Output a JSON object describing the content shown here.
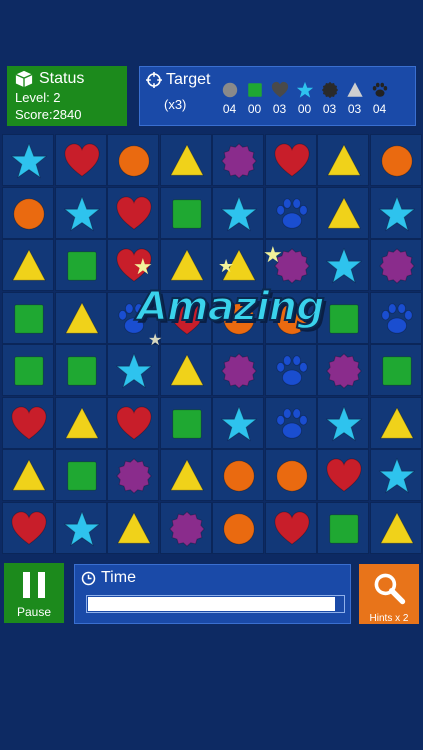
{
  "status": {
    "title": "Status",
    "level": "Level: 2",
    "score": "Score:2840"
  },
  "target": {
    "title": "Target",
    "multiplier": "(x3)",
    "items": [
      {
        "icon": "gray-circle-icon",
        "count": "04"
      },
      {
        "icon": "green-square-icon",
        "count": "00"
      },
      {
        "icon": "gray-heart-icon",
        "count": "03"
      },
      {
        "icon": "blue-star-icon",
        "count": "00"
      },
      {
        "icon": "dark-flower-icon",
        "count": "03"
      },
      {
        "icon": "gray-triangle-icon",
        "count": "03"
      },
      {
        "icon": "gray-paw-icon",
        "count": "04"
      }
    ]
  },
  "board": {
    "rows": [
      [
        "star",
        "heart",
        "circle",
        "triangle",
        "flower",
        "heart",
        "triangle",
        "circle"
      ],
      [
        "circle",
        "star",
        "heart",
        "square",
        "star",
        "paw",
        "triangle",
        "star"
      ],
      [
        "triangle",
        "square",
        "heart",
        "triangle",
        "triangle",
        "flower",
        "star",
        "flower"
      ],
      [
        "square",
        "triangle",
        "paw",
        "heart",
        "circle",
        "circle",
        "square",
        "paw"
      ],
      [
        "square",
        "square",
        "star",
        "triangle",
        "flower",
        "paw",
        "flower",
        "square"
      ],
      [
        "heart",
        "triangle",
        "heart",
        "square",
        "star",
        "paw",
        "star",
        "triangle"
      ],
      [
        "triangle",
        "square",
        "flower",
        "triangle",
        "circle",
        "circle",
        "heart",
        "star"
      ],
      [
        "heart",
        "star",
        "triangle",
        "flower",
        "circle",
        "heart",
        "square",
        "triangle"
      ]
    ]
  },
  "banner": "Amazing",
  "pause_label": "Pause",
  "time": {
    "label": "Time",
    "progress": 0.98
  },
  "hints_label": "Hints x 2",
  "colors": {
    "star": "#2ec3ee",
    "heart": "#c81e2a",
    "circle": "#ea6a10",
    "triangle": "#f0d21a",
    "flower": "#8a2c8c",
    "square": "#1fa832",
    "paw": "#1a4ed0"
  }
}
